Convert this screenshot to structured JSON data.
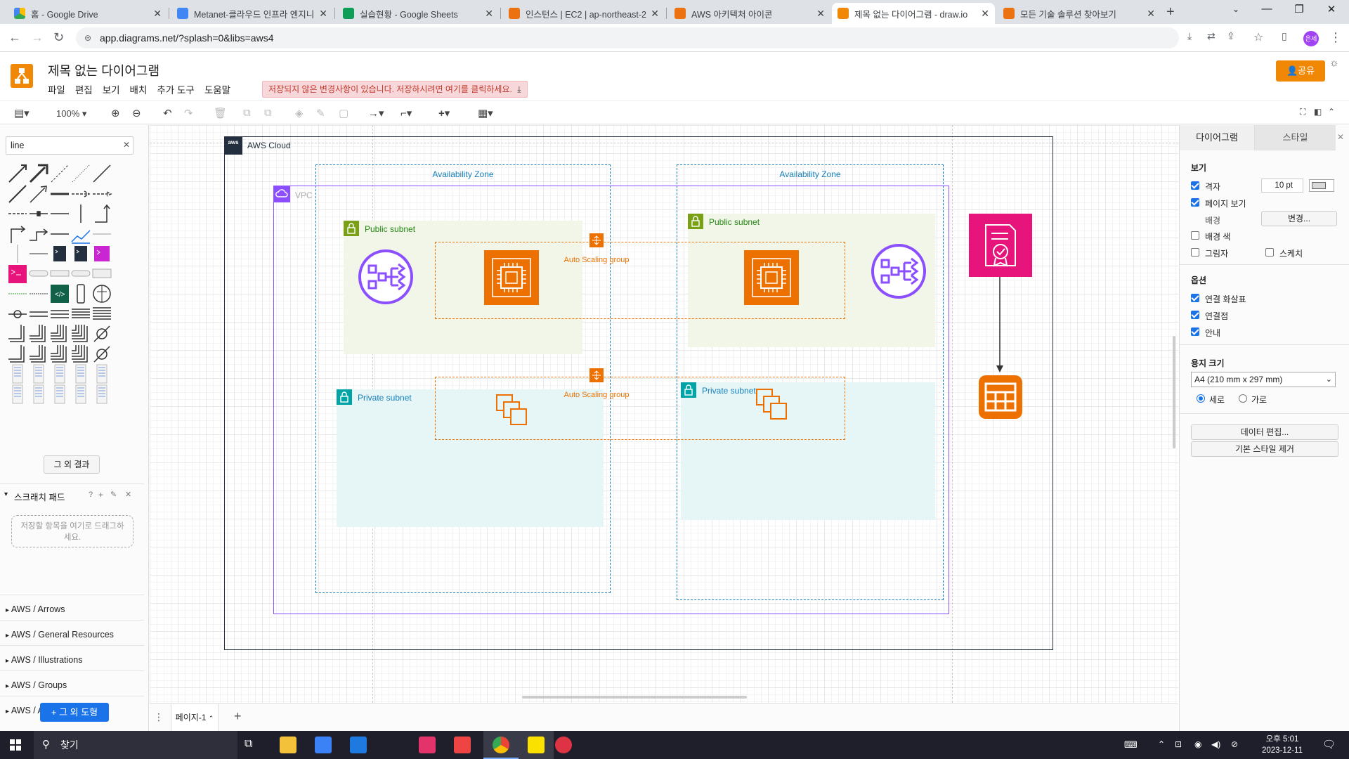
{
  "browser": {
    "tabs": [
      {
        "title": "홈 - Google Drive",
        "color": "#1a73e8"
      },
      {
        "title": "Metanet-클라우드 인프라 엔지니어",
        "color": "#4285f4"
      },
      {
        "title": "실습현황 - Google Sheets",
        "color": "#0f9d58"
      },
      {
        "title": "인스턴스 | EC2 | ap-northeast-2",
        "color": "#ec7211"
      },
      {
        "title": "AWS 아키텍처 아이콘",
        "color": "#ec7211"
      },
      {
        "title": "제목 없는 다이어그램 - draw.io",
        "color": "#f08705"
      },
      {
        "title": "모든 기술 솔루션 찾아보기",
        "color": "#ec7211"
      }
    ],
    "new_tab": "+",
    "url": "app.diagrams.net/?splash=0&libs=aws4",
    "profile": "은세"
  },
  "app": {
    "title": "제목 없는 다이어그램",
    "menu": [
      "파일",
      "편집",
      "보기",
      "배치",
      "추가 도구",
      "도움말"
    ],
    "unsaved_notice": "저장되지 않은 변경사항이 있습니다. 저장하시려면 여기를 클릭하세요.",
    "share_label": "공유",
    "zoom": "100%"
  },
  "left": {
    "search_value": "line",
    "more_results": "그 외 결과",
    "scratchpad_title": "스크래치 패드",
    "scratchpad_hint": "저장할 항목을 여기로 드래그하세요.",
    "scratchpad_help": "?",
    "libraries": [
      "AWS / Arrows",
      "AWS / General Resources",
      "AWS / Illustrations",
      "AWS / Groups",
      "AWS / Analytics"
    ],
    "more_shapes": "+ 그 외 도형"
  },
  "diagram": {
    "cloud_label": "AWS Cloud",
    "aws_badge": "aws",
    "az_label": "Availability Zone",
    "vpc_label": "VPC",
    "public_subnet": "Public subnet",
    "private_subnet": "Private subnet",
    "asg_label": "Auto Scaling group"
  },
  "right": {
    "tab_diagram": "다이어그램",
    "tab_style": "스타일",
    "view_section": "보기",
    "grid": "격자",
    "grid_size": "10 pt",
    "page_view": "페이지 보기",
    "background": "배경",
    "change_btn": "변경...",
    "bg_color": "배경 색",
    "shadow": "그림자",
    "sketch": "스케치",
    "options_section": "옵션",
    "connection_arrows": "연결 화살표",
    "connection_points": "연결점",
    "guides": "안내",
    "paper_section": "용지 크기",
    "paper_size": "A4 (210 mm x 297 mm)",
    "portrait": "세로",
    "landscape": "가로",
    "edit_data": "데이터 편집...",
    "clear_style": "기본 스타일 제거"
  },
  "pagebar": {
    "page_name": "페이지-1",
    "add": "+"
  },
  "taskbar": {
    "search": "찾기",
    "time": "오후 5:01",
    "date": "2023-12-11"
  },
  "colors": {
    "aws_orange": "#ed7100",
    "vpc_purple": "#8c4fff",
    "subnet_green": "#7aa116",
    "subnet_teal": "#00a4a6",
    "cert_pink": "#e7157b",
    "drawio_orange": "#f08705"
  }
}
